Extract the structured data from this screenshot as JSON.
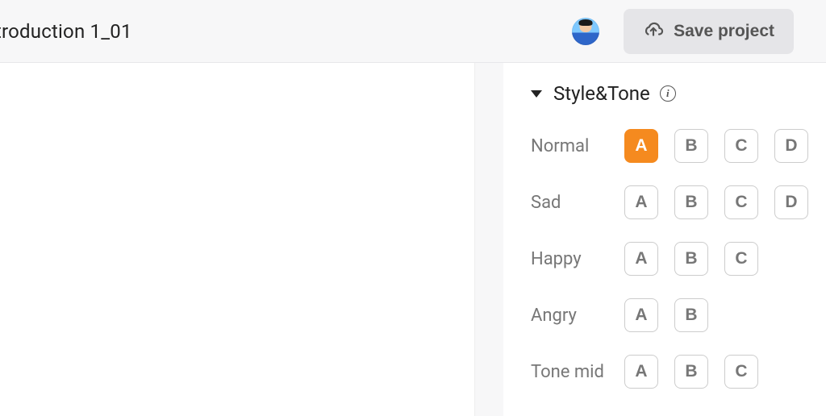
{
  "header": {
    "title": "troduction 1_01",
    "save_label": "Save project"
  },
  "panel": {
    "section_title": "Style&Tone",
    "rows": [
      {
        "label": "Normal",
        "options": [
          "A",
          "B",
          "C",
          "D"
        ],
        "selected": 0
      },
      {
        "label": "Sad",
        "options": [
          "A",
          "B",
          "C",
          "D"
        ],
        "selected": -1
      },
      {
        "label": "Happy",
        "options": [
          "A",
          "B",
          "C"
        ],
        "selected": -1
      },
      {
        "label": "Angry",
        "options": [
          "A",
          "B"
        ],
        "selected": -1
      },
      {
        "label": "Tone mid",
        "options": [
          "A",
          "B",
          "C"
        ],
        "selected": -1
      }
    ]
  }
}
